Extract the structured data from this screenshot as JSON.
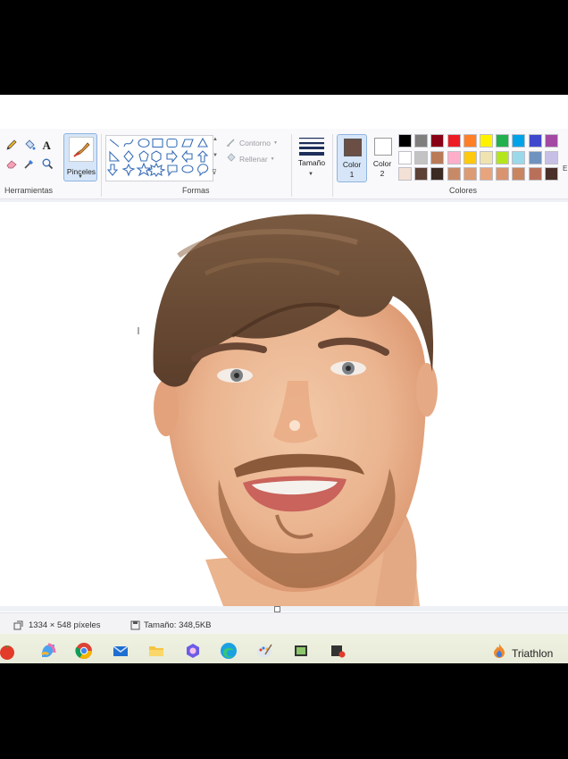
{
  "ribbon": {
    "groups": {
      "tools": "Herramientas",
      "shapes": "Formas",
      "colors": "Colores"
    },
    "brush_label": "Pinceles",
    "outline_label": "Contorno",
    "fill_label": "Rellenar",
    "size_label": "Tamaño",
    "color1_label": "Color\n1",
    "color2_label": "Color\n2",
    "color1_value": "#6b4f45",
    "color2_value": "#ffffff",
    "palette": [
      [
        "#000000",
        "#7f7f7f",
        "#880015",
        "#ed1c24",
        "#ff7f27",
        "#fff200",
        "#22b14c",
        "#00a2e8",
        "#3f48cc",
        "#a349a4"
      ],
      [
        "#ffffff",
        "#c3c3c3",
        "#b97a57",
        "#ffaec9",
        "#ffc90e",
        "#efe4b0",
        "#b5e61d",
        "#99d9ea",
        "#7092be",
        "#c8bfe7"
      ],
      [
        "#f4e1d6",
        "#5d4036",
        "#3b2a22",
        "#c88a66",
        "#dc9b72",
        "#e8a57d",
        "#d9946f",
        "#c98560",
        "#b9705a",
        "#4a3028"
      ]
    ]
  },
  "status": {
    "dimensions": "1334 × 548 píxeles",
    "size": "Tamaño: 348,5KB"
  },
  "taskbar": {
    "triathlon_label": "Triathlon"
  }
}
